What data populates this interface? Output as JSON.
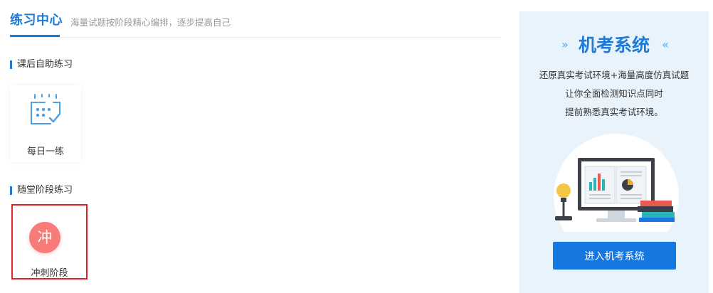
{
  "header": {
    "title": "练习中心",
    "subtitle": "海量试题按阶段精心编排，逐步提高自己"
  },
  "sections": [
    {
      "title": "课后自助练习",
      "items": [
        {
          "label": "每日一练",
          "icon": "calendar-check-icon"
        }
      ]
    },
    {
      "title": "随堂阶段练习",
      "items": [
        {
          "label": "冲刺阶段",
          "icon_char": "冲",
          "highlighted": true
        }
      ]
    }
  ],
  "promo": {
    "title": "机考系统",
    "arrow_left": "»",
    "arrow_right": "«",
    "lines": [
      "还原真实考试环境+海量高度仿真试题",
      "让你全面检测知识点同时",
      "提前熟悉真实考试环境。"
    ],
    "button_label": "进入机考系统"
  },
  "colors": {
    "accent": "#1f7ad6",
    "button": "#1677e0",
    "sprint_circle": "#f77b79",
    "highlight_border": "#e0232a",
    "promo_bg": "#e8f3fc"
  }
}
